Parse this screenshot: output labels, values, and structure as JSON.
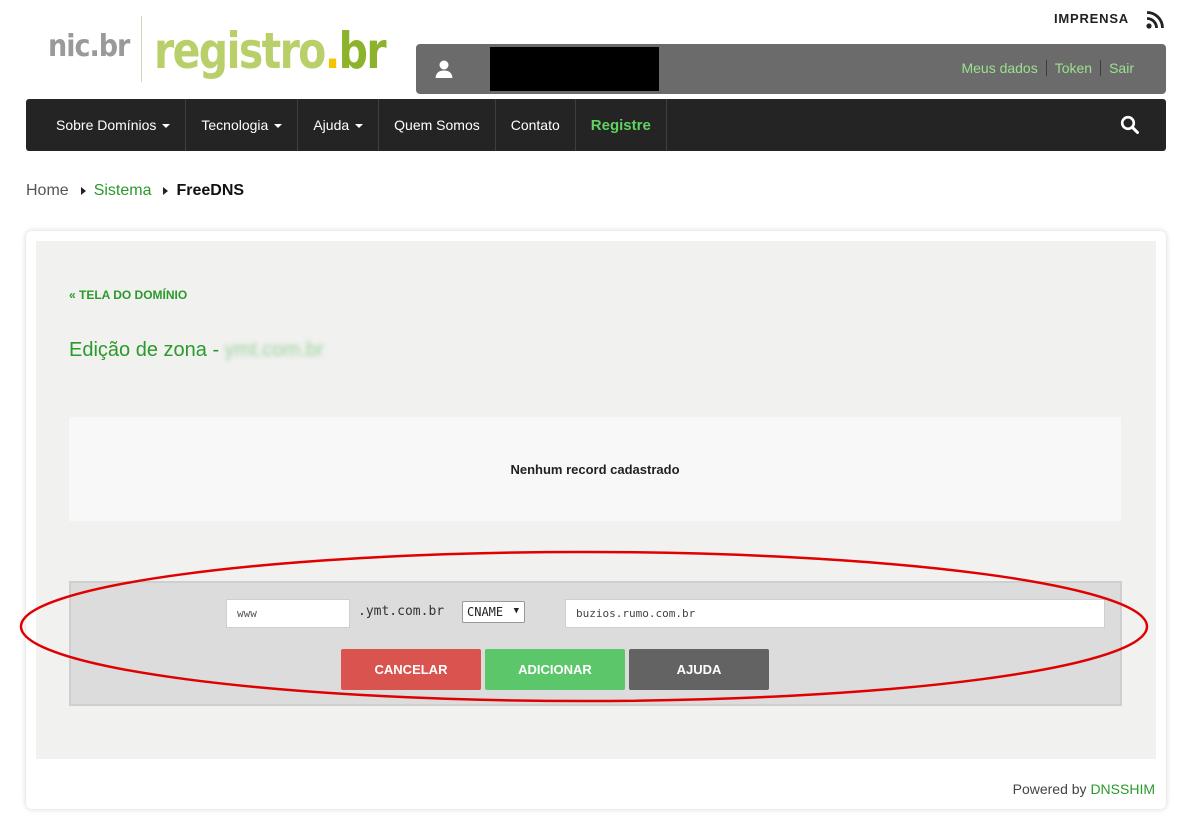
{
  "header": {
    "logo": {
      "nic": "nic.br",
      "registro": "registro",
      "br": "br"
    },
    "imprensa_label": "IMPRENSA"
  },
  "userbar": {
    "links": [
      "Meus dados",
      "Token",
      "Sair"
    ]
  },
  "nav": {
    "items": [
      {
        "label": "Sobre Domínios",
        "dropdown": true
      },
      {
        "label": "Tecnologia",
        "dropdown": true
      },
      {
        "label": "Ajuda",
        "dropdown": true
      },
      {
        "label": "Quem Somos",
        "dropdown": false
      },
      {
        "label": "Contato",
        "dropdown": false
      },
      {
        "label": "Registre",
        "dropdown": false
      }
    ]
  },
  "breadcrumb": {
    "home": "Home",
    "sistema": "Sistema",
    "current": "FreeDNS"
  },
  "main": {
    "back_link": "« TELA DO DOMÍNIO",
    "title": "Edição de zona - ",
    "domain": "ymt.com.br",
    "empty_message": "Nenhum record cadastrado",
    "form": {
      "name_value": "www",
      "suffix": ".ymt.com.br",
      "type_value": "CNAME",
      "target_value": "buzios.rumo.com.br",
      "cancel_label": "CANCELAR",
      "add_label": "ADICIONAR",
      "help_label": "AJUDA"
    },
    "powered_prefix": "Powered by ",
    "powered_link": "DNSSHIM"
  },
  "colors": {
    "brand_green": "#2a9a2a",
    "registre_green": "#5fd25f",
    "cancel_red": "#d9534f",
    "add_green": "#5cc66a",
    "help_gray": "#636363",
    "annotation_red": "#e00000"
  }
}
